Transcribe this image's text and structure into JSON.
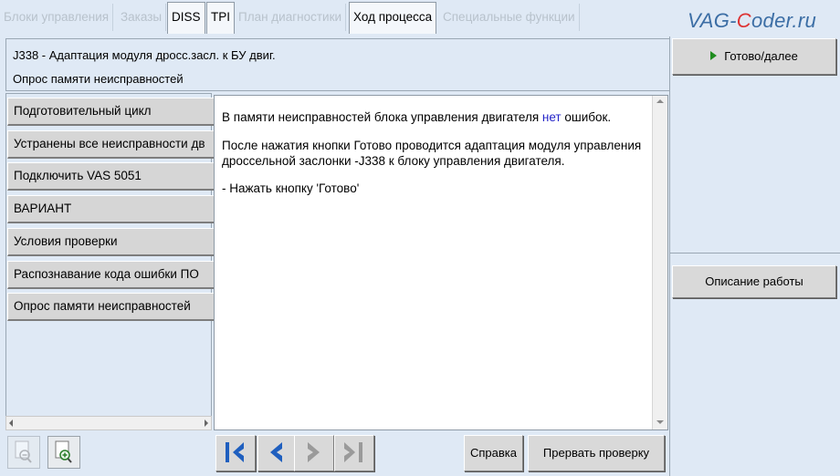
{
  "tabs": [
    {
      "label": "Блоки управления"
    },
    {
      "label": "Заказы"
    },
    {
      "label": "DISS"
    },
    {
      "label": "TPI"
    },
    {
      "label": "План диагностики"
    },
    {
      "label": "Ход процесса"
    },
    {
      "label": "Специальные функции"
    }
  ],
  "brand": {
    "prefix": "VAG-",
    "c": "C",
    "suffix": "oder.ru"
  },
  "header": {
    "line1": "J338 - Адаптация модуля дросс.засл. к БУ двиг.",
    "line2": "Опрос памяти неисправностей"
  },
  "steps": [
    "Подготовительный цикл",
    "Устранены все неисправности дв",
    "Подключить VAS 5051",
    "ВАРИАНТ",
    "Условия проверки",
    "Распознавание кода ошибки ПО",
    "Опрос памяти неисправностей"
  ],
  "content": {
    "p1_before": "В памяти неисправностей блока управления двигателя ",
    "p1_highlight": "нет",
    "p1_after": " ошибок.",
    "p2_line1": "После нажатия кнопки Готово проводится адаптация модуля управления",
    "p2_line2": "дроссельной заслонки -J338 к блоку управления двигателя.",
    "p3": "- Нажать кнопку 'Готово'"
  },
  "buttons": {
    "done": "Готово/далее",
    "work_description": "Описание работы",
    "help": "Справка",
    "abort": "Прервать проверку"
  },
  "colors": {
    "background": "#dfe9f5",
    "highlight_text": "#2424c8",
    "nav_arrow": "#1f5fbf",
    "play_icon": "#1e8c1e"
  }
}
